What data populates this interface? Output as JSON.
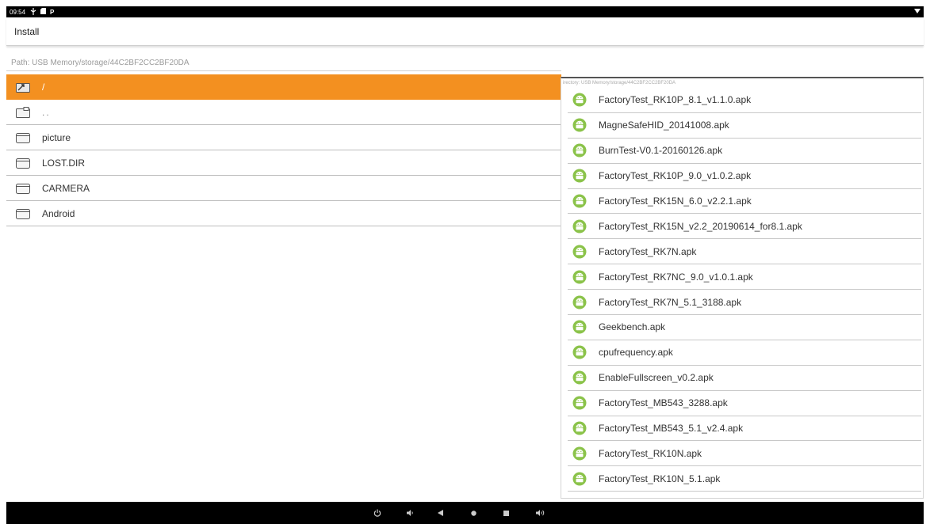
{
  "status_bar": {
    "time": "09:54",
    "usb_icon": "usb-icon",
    "sd_icon": "sd-card-icon",
    "p_icon": "P",
    "wifi_icon": "wifi-icon"
  },
  "app": {
    "title": "Install"
  },
  "path": {
    "label": "Path:  USB Memory/storage/44C2BF2CC2BF20DA"
  },
  "folders": [
    {
      "name": "/",
      "icon": "folder-up-icon",
      "selected": true
    },
    {
      "name": "..",
      "icon": "folder-parent-icon",
      "selected": false
    },
    {
      "name": "picture",
      "icon": "folder-icon",
      "selected": false
    },
    {
      "name": "LOST.DIR",
      "icon": "folder-icon",
      "selected": false
    },
    {
      "name": "CARMERA",
      "icon": "folder-icon",
      "selected": false
    },
    {
      "name": "Android",
      "icon": "folder-icon",
      "selected": false
    }
  ],
  "apk_panel": {
    "directory": "irectory:  USB Memory/storage/44C2BF2CC2BF20DA",
    "files": [
      "FactoryTest_RK10P_8.1_v1.1.0.apk",
      "MagneSafeHID_20141008.apk",
      "BurnTest-V0.1-20160126.apk",
      "FactoryTest_RK10P_9.0_v1.0.2.apk",
      "FactoryTest_RK15N_6.0_v2.2.1.apk",
      "FactoryTest_RK15N_v2.2_20190614_for8.1.apk",
      "FactoryTest_RK7N.apk",
      "FactoryTest_RK7NC_9.0_v1.0.1.apk",
      "FactoryTest_RK7N_5.1_3188.apk",
      "Geekbench.apk",
      "cpufrequency.apk",
      "EnableFullscreen_v0.2.apk",
      "FactoryTest_MB543_3288.apk",
      "FactoryTest_MB543_5.1_v2.4.apk",
      "FactoryTest_RK10N.apk",
      "FactoryTest_RK10N_5.1.apk"
    ]
  },
  "nav_bar": {
    "buttons": [
      "power-icon",
      "volume-down-icon",
      "back-icon",
      "home-icon",
      "recents-icon",
      "volume-up-icon"
    ]
  },
  "colors": {
    "selected_row": "#f39020",
    "android_green": "#8bc34a",
    "bar_black": "#000000"
  }
}
